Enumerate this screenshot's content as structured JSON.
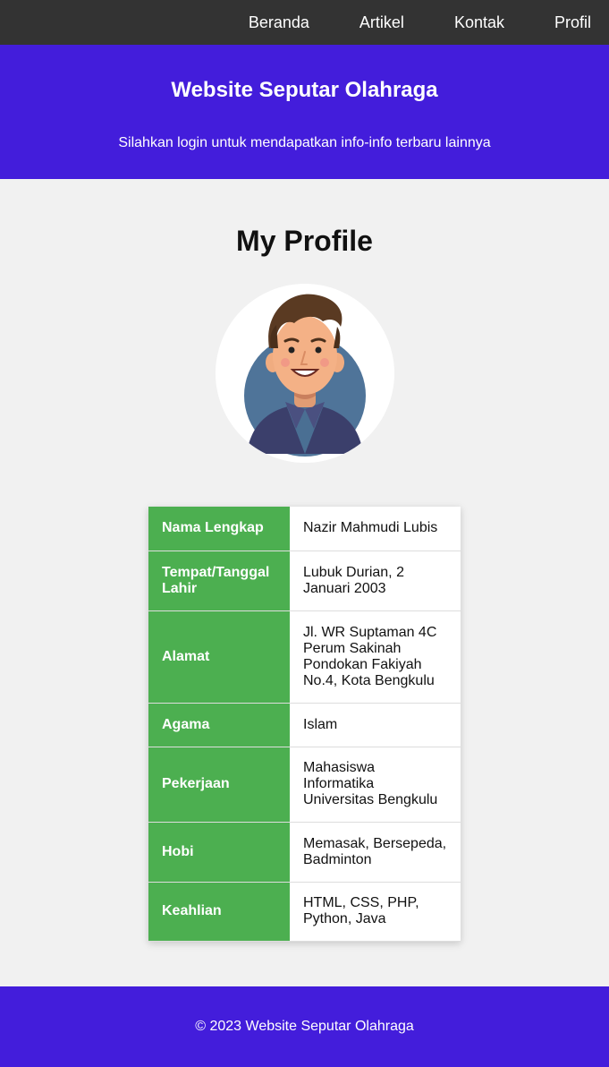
{
  "nav": {
    "items": [
      {
        "label": "Beranda"
      },
      {
        "label": "Artikel"
      },
      {
        "label": "Kontak"
      },
      {
        "label": "Profil"
      }
    ]
  },
  "header": {
    "title": "Website Seputar Olahraga",
    "subtitle": "Silahkan login untuk mendapatkan info-info terbaru lainnya"
  },
  "main": {
    "title": "My Profile",
    "avatar_icon": "person-avatar-icon"
  },
  "profile": {
    "rows": [
      {
        "key": "Nama Lengkap",
        "value": "Nazir Mahmudi Lubis"
      },
      {
        "key": "Tempat/Tanggal Lahir",
        "value": "Lubuk Durian, 2 Januari 2003"
      },
      {
        "key": "Alamat",
        "value": "Jl. WR Suptaman 4C Perum Sakinah Pondokan Fakiyah No.4, Kota Bengkulu"
      },
      {
        "key": "Agama",
        "value": "Islam"
      },
      {
        "key": "Pekerjaan",
        "value": "Mahasiswa Informatika Universitas Bengkulu"
      },
      {
        "key": "Hobi",
        "value": "Memasak, Bersepeda, Badminton"
      },
      {
        "key": "Keahlian",
        "value": "HTML, CSS, PHP, Python, Java"
      }
    ]
  },
  "footer": {
    "text": "© 2023 Website Seputar Olahraga"
  },
  "colors": {
    "nav_bg": "#333333",
    "brand": "#431ddb",
    "key_cell": "#4caf50",
    "page_bg": "#f1f1f1"
  }
}
